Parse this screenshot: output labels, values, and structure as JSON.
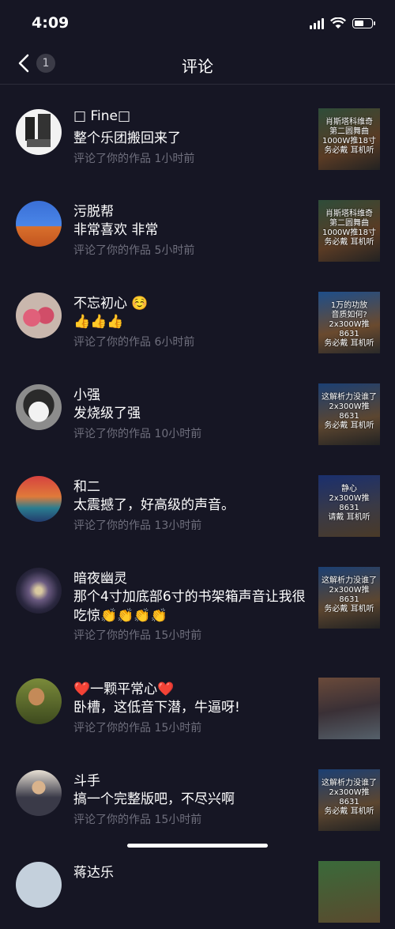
{
  "status": {
    "time": "4:09"
  },
  "nav": {
    "title": "评论",
    "badge": "1"
  },
  "comments": [
    {
      "name": "□ Fine□",
      "text": "整个乐团搬回来了",
      "meta": "评论了你的作品  1小时前",
      "thumb_text": "肖斯塔科维奇\n第二圆舞曲\n1000W推18寸\n务必戴   耳机听"
    },
    {
      "name": "污脱帮",
      "text": "非常喜欢 非常",
      "meta": "评论了你的作品  5小时前",
      "thumb_text": "肖斯塔科维奇\n第二圆舞曲\n1000W推18寸\n务必戴   耳机听"
    },
    {
      "name": "不忘初心 ☺️",
      "text": "👍👍👍",
      "meta": "评论了你的作品  6小时前",
      "thumb_text": "1万的功放\n音质如何?\n2x300W推8631\n务必戴   耳机听"
    },
    {
      "name": "小强",
      "text": "发烧级了强",
      "meta": "评论了你的作品  10小时前",
      "thumb_text": "这解析力没谁了\n2x300W推8631\n务必戴   耳机听"
    },
    {
      "name": "和二",
      "text": "太震撼了，好高级的声音。",
      "meta": "评论了你的作品  13小时前",
      "thumb_text": "静心\n2x300W推8631\n请戴   耳机听"
    },
    {
      "name": "暗夜幽灵",
      "text": "那个4寸加底部6寸的书架箱声音让我很吃惊👏👏👏👏",
      "meta": "评论了你的作品  15小时前",
      "thumb_text": "这解析力没谁了\n2x300W推8631\n务必戴   耳机听"
    },
    {
      "name": "❤️一颗平常心❤️",
      "text": "卧槽，这低音下潜，牛逼呀!",
      "meta": "评论了你的作品  15小时前",
      "thumb_text": ""
    },
    {
      "name": "斗手",
      "text": "搞一个完整版吧，不尽兴啊",
      "meta": "评论了你的作品  15小时前",
      "thumb_text": "这解析力没谁了\n2x300W推8631\n务必戴   耳机听"
    },
    {
      "name": "蒋达乐",
      "text": "",
      "meta": "",
      "thumb_text": ""
    }
  ]
}
